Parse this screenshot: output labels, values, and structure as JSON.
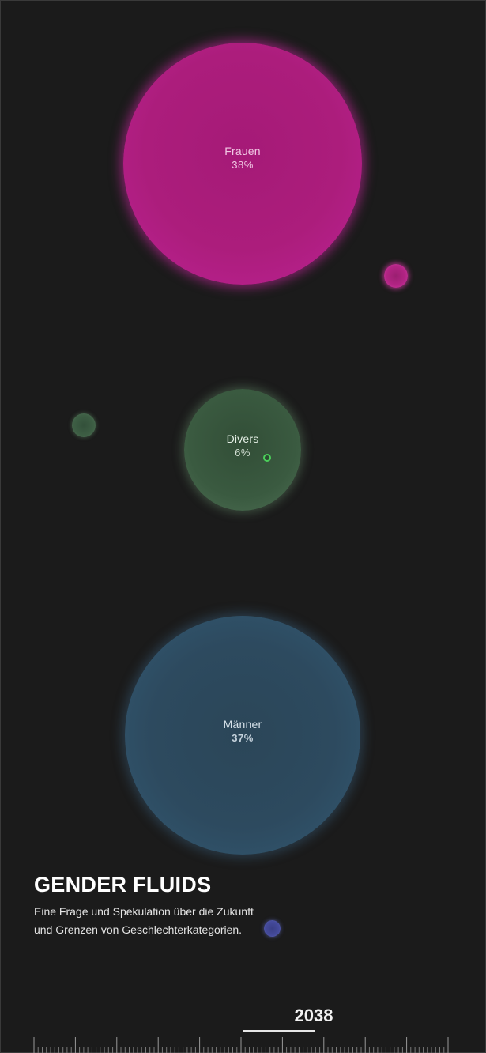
{
  "bubbles": {
    "frauen": {
      "label": "Frauen",
      "percent": "38%",
      "color": "#ac1d7c"
    },
    "divers": {
      "label": "Divers",
      "percent": "6%",
      "color": "#3a5a40"
    },
    "maenner": {
      "label": "Männer",
      "percent": "37%",
      "color": "#2d4a5f"
    }
  },
  "dots": {
    "pink": {
      "color": "#b22484"
    },
    "green": {
      "color": "#3d5e44"
    },
    "ring": {
      "color": "#4bd05a"
    },
    "blue": {
      "color": "#454b9c"
    }
  },
  "header": {
    "title": "GENDER FLUIDS",
    "subtitle_line1": "Eine Frage und Spekulation über die Zukunft",
    "subtitle_line2": "und Grenzen von Geschlechterkategorien."
  },
  "timeline": {
    "year": "2038"
  },
  "theme": {
    "background": "#1b1b1b",
    "text": "#ffffff"
  }
}
